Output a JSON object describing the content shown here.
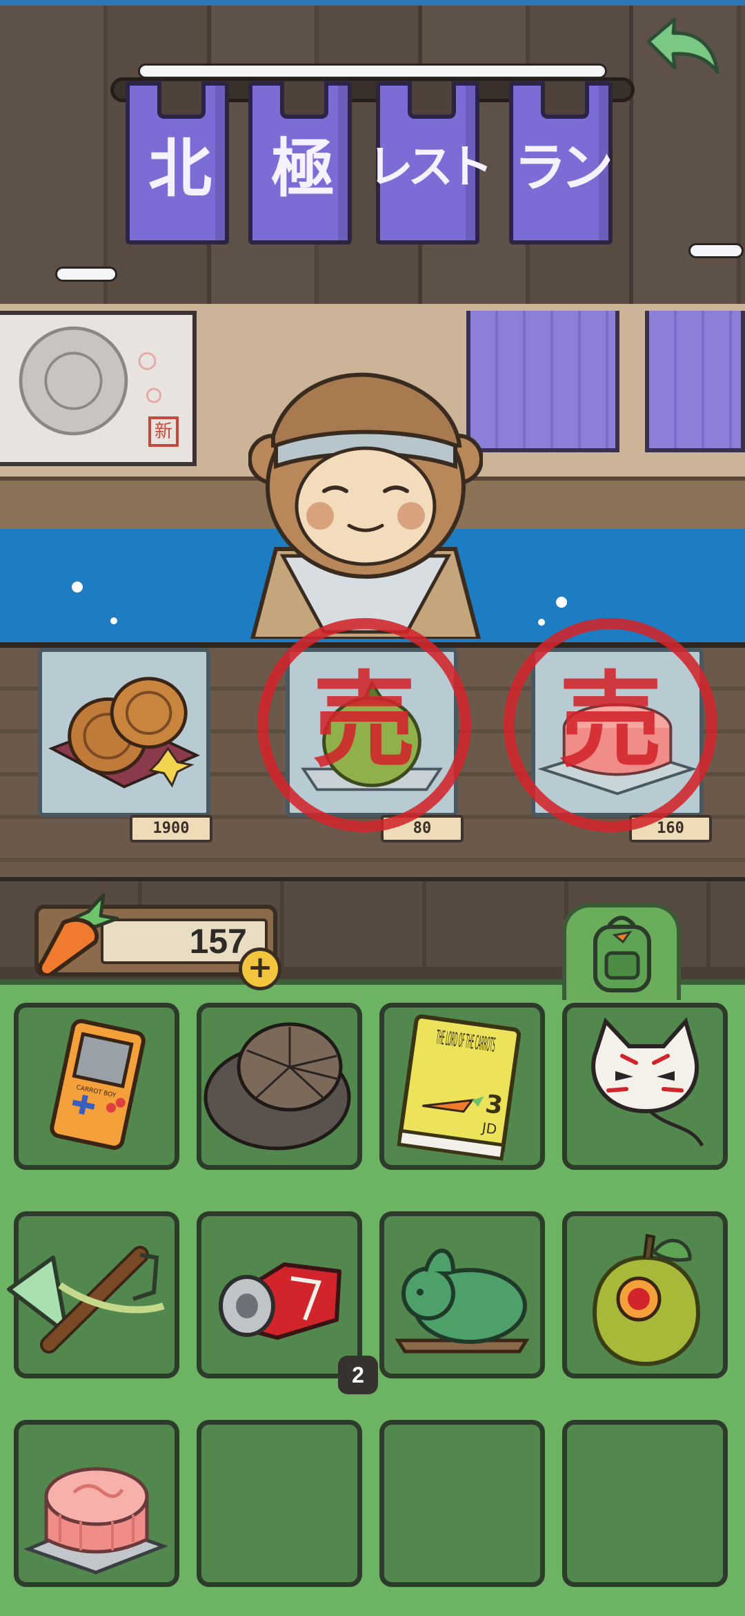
{
  "shop": {
    "sign": [
      "北",
      "極",
      "レスト",
      "ラン"
    ],
    "poster_stamp": "新"
  },
  "counter": {
    "items": [
      {
        "name": "mooncakes",
        "price": "1900",
        "sold": false
      },
      {
        "name": "pomelo",
        "price": "80",
        "sold": true
      },
      {
        "name": "snow-skin-mooncake",
        "price": "160",
        "sold": true
      }
    ],
    "sold_mark": "売"
  },
  "currency": {
    "amount": "157",
    "plus_label": "+"
  },
  "inventory": {
    "slots": [
      {
        "item": "gameboy-icon",
        "count": ""
      },
      {
        "item": "pine-straw-hat-icon",
        "count": ""
      },
      {
        "item": "lord-of-the-carrots-book-icon",
        "count": "",
        "book_title": "THE LORD OF THE CARROTS",
        "book_number": "3",
        "book_author": "JD"
      },
      {
        "item": "fox-mask-icon",
        "count": ""
      },
      {
        "item": "slingshot-icon",
        "count": ""
      },
      {
        "item": "crushed-can-icon",
        "count": "2"
      },
      {
        "item": "jade-rabbit-icon",
        "count": ""
      },
      {
        "item": "pomelo-icon",
        "count": ""
      },
      {
        "item": "pink-mooncake-icon",
        "count": ""
      },
      {
        "item": "empty",
        "count": ""
      },
      {
        "item": "empty",
        "count": ""
      },
      {
        "item": "empty",
        "count": ""
      }
    ],
    "gameboy_label": "CARROT BOY"
  },
  "colors": {
    "noren": "#7c6cd6",
    "sold_red": "#d2252b",
    "inventory_green": "#6cb464",
    "slot_green": "#52874d"
  }
}
